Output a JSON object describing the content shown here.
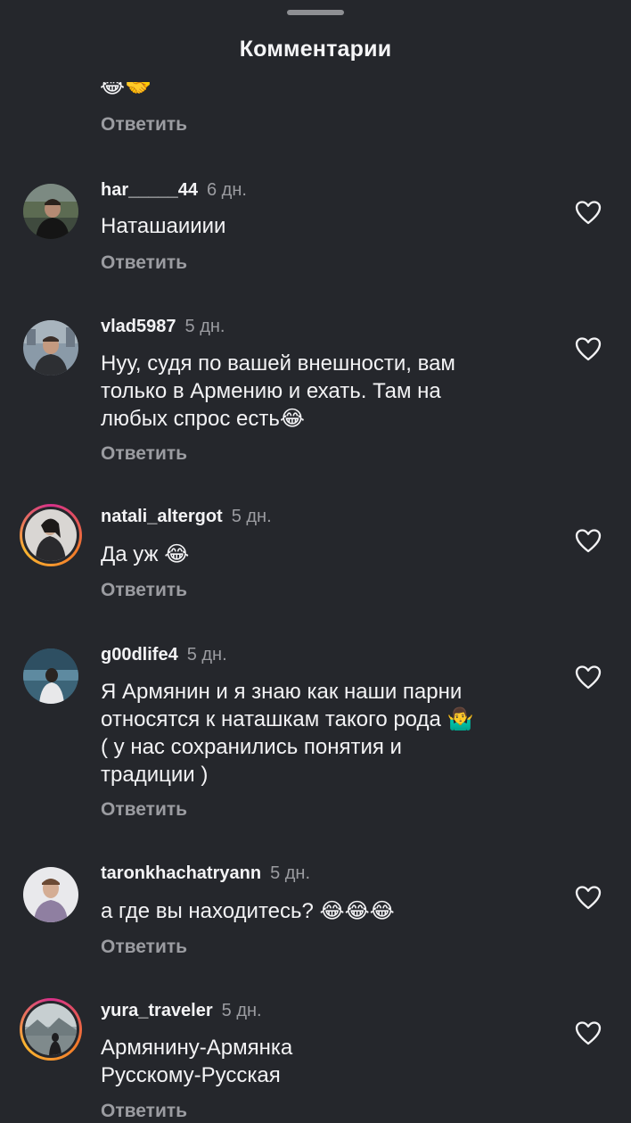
{
  "header": {
    "title": "Комментарии"
  },
  "partial_comment": {
    "text": "😂🤝",
    "reply_label": "Ответить"
  },
  "comments": [
    {
      "username": "har_____44",
      "time": "6 дн.",
      "text": "Наташаииии",
      "reply_label": "Ответить"
    },
    {
      "username": "vlad5987",
      "time": "5 дн.",
      "text": "Нуу, судя по вашей внешности, вам\nтолько в Армению и ехать. Там на\nлюбых спрос есть😂",
      "reply_label": "Ответить"
    },
    {
      "username": "natali_altergot",
      "time": "5 дн.",
      "text": "Да уж 😂",
      "reply_label": "Ответить"
    },
    {
      "username": "g00dlife4",
      "time": "5 дн.",
      "text": "Я Армянин и я знаю как наши парни\nотносятся к наташкам такого рода 🤷‍♂️\n( у нас сохранились понятия и\nтрадиции )",
      "reply_label": "Ответить"
    },
    {
      "username": "taronkhachatryann",
      "time": "5 дн.",
      "text": "а где вы находитесь? 😂😂😂",
      "reply_label": "Ответить"
    },
    {
      "username": "yura_traveler",
      "time": "5 дн.",
      "text": "Армянину-Армянка\nРусскому-Русская",
      "reply_label": "Ответить"
    }
  ],
  "icons": {
    "like": "heart-outline-icon"
  },
  "colors": {
    "background": "#25272c",
    "secondary_text": "#9b9ca1",
    "story_ring_start": "#d62f8a",
    "story_ring_end": "#f9b531"
  }
}
